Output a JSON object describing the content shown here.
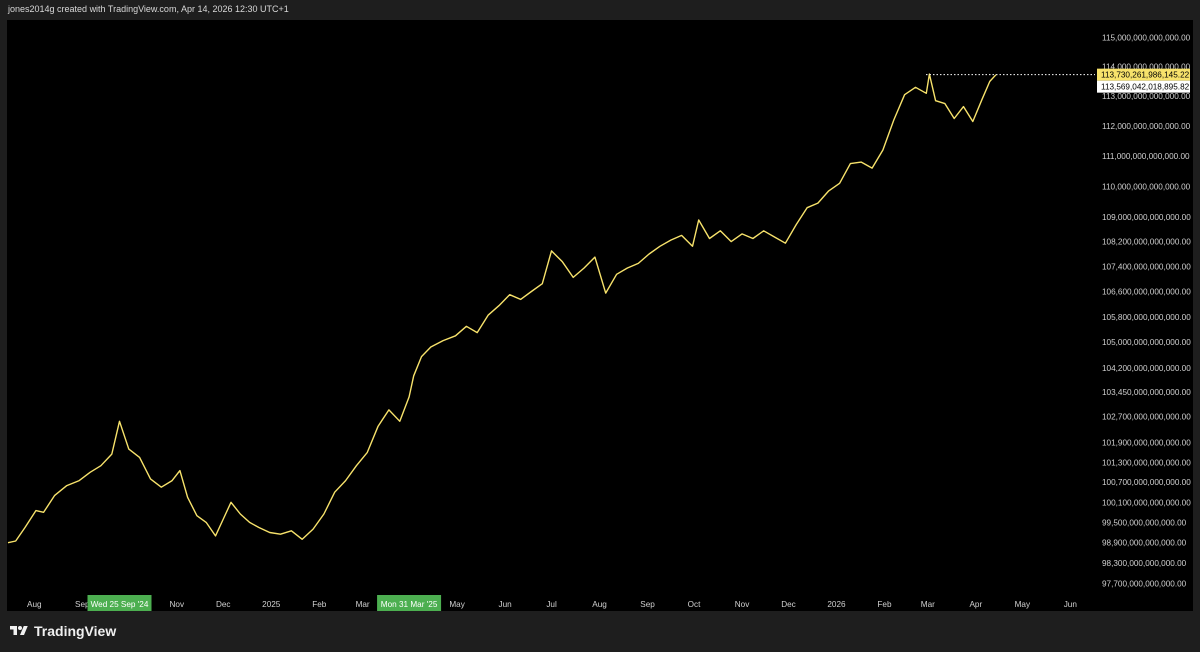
{
  "header": {
    "credit": "jones2014g created with TradingView.com, Apr 14, 2026 12:30 UTC+1"
  },
  "footer": {
    "brand": "TradingView"
  },
  "colors": {
    "line": "#f7e26b",
    "background": "#000000",
    "frame": "#1e1e1e",
    "axis_text": "#d0d0d0",
    "last_price_tag": "#f7e26b",
    "date_tag": "#4caf50"
  },
  "chart_data": {
    "type": "line",
    "title": "",
    "xlabel": "",
    "ylabel": "",
    "scale": "log",
    "grid": false,
    "series": [
      {
        "values": [
          [
            "2024-07-15",
            98900000000000.0
          ],
          [
            "2024-07-20",
            98950000000000.0
          ],
          [
            "2024-07-26",
            99350000000000.0
          ],
          [
            "2024-08-02",
            99850000000000.0
          ],
          [
            "2024-08-07",
            99800000000000.0
          ],
          [
            "2024-08-14",
            100300000000000.0
          ],
          [
            "2024-08-22",
            100600000000000.0
          ],
          [
            "2024-08-30",
            100750000000000.0
          ],
          [
            "2024-09-06",
            101000000000000.0
          ],
          [
            "2024-09-13",
            101200000000000.0
          ],
          [
            "2024-09-20",
            101550000000000.0
          ],
          [
            "2024-09-25",
            102550000000000.0
          ],
          [
            "2024-10-01",
            101700000000000.0
          ],
          [
            "2024-10-08",
            101450000000000.0
          ],
          [
            "2024-10-15",
            100800000000000.0
          ],
          [
            "2024-10-22",
            100550000000000.0
          ],
          [
            "2024-10-29",
            100750000000000.0
          ],
          [
            "2024-11-03",
            101050000000000.0
          ],
          [
            "2024-11-08",
            100250000000000.0
          ],
          [
            "2024-11-14",
            99700000000000.0
          ],
          [
            "2024-11-20",
            99500000000000.0
          ],
          [
            "2024-11-26",
            99100000000000.0
          ],
          [
            "2024-12-01",
            99600000000000.0
          ],
          [
            "2024-12-06",
            100100000000000.0
          ],
          [
            "2024-12-12",
            99750000000000.0
          ],
          [
            "2024-12-18",
            99500000000000.0
          ],
          [
            "2024-12-24",
            99350000000000.0
          ],
          [
            "2024-12-31",
            99200000000000.0
          ],
          [
            "2025-01-07",
            99150000000000.0
          ],
          [
            "2025-01-14",
            99250000000000.0
          ],
          [
            "2025-01-21",
            99000000000000.0
          ],
          [
            "2025-01-28",
            99300000000000.0
          ],
          [
            "2025-02-04",
            99750000000000.0
          ],
          [
            "2025-02-11",
            100400000000000.0
          ],
          [
            "2025-02-18",
            100750000000000.0
          ],
          [
            "2025-02-25",
            101200000000000.0
          ],
          [
            "2025-03-04",
            101600000000000.0
          ],
          [
            "2025-03-11",
            102400000000000.0
          ],
          [
            "2025-03-18",
            102900000000000.0
          ],
          [
            "2025-03-25",
            102550000000000.0
          ],
          [
            "2025-03-31",
            103300000000000.0
          ],
          [
            "2025-04-03",
            103950000000000.0
          ],
          [
            "2025-04-08",
            104550000000000.0
          ],
          [
            "2025-04-14",
            104850000000000.0
          ],
          [
            "2025-04-22",
            105050000000000.0
          ],
          [
            "2025-04-30",
            105200000000000.0
          ],
          [
            "2025-05-07",
            105500000000000.0
          ],
          [
            "2025-05-14",
            105300000000000.0
          ],
          [
            "2025-05-21",
            105850000000000.0
          ],
          [
            "2025-05-28",
            106150000000000.0
          ],
          [
            "2025-06-04",
            106500000000000.0
          ],
          [
            "2025-06-11",
            106350000000000.0
          ],
          [
            "2025-06-18",
            106600000000000.0
          ],
          [
            "2025-06-25",
            106850000000000.0
          ],
          [
            "2025-07-01",
            107900000000000.0
          ],
          [
            "2025-07-08",
            107550000000000.0
          ],
          [
            "2025-07-15",
            107050000000000.0
          ],
          [
            "2025-07-22",
            107350000000000.0
          ],
          [
            "2025-07-29",
            107700000000000.0
          ],
          [
            "2025-08-05",
            106550000000000.0
          ],
          [
            "2025-08-12",
            107150000000000.0
          ],
          [
            "2025-08-19",
            107350000000000.0
          ],
          [
            "2025-08-26",
            107500000000000.0
          ],
          [
            "2025-09-02",
            107800000000000.0
          ],
          [
            "2025-09-09",
            108050000000000.0
          ],
          [
            "2025-09-16",
            108250000000000.0
          ],
          [
            "2025-09-23",
            108400000000000.0
          ],
          [
            "2025-09-30",
            108050000000000.0
          ],
          [
            "2025-10-04",
            108900000000000.0
          ],
          [
            "2025-10-11",
            108300000000000.0
          ],
          [
            "2025-10-18",
            108550000000000.0
          ],
          [
            "2025-10-25",
            108200000000000.0
          ],
          [
            "2025-11-01",
            108450000000000.0
          ],
          [
            "2025-11-08",
            108300000000000.0
          ],
          [
            "2025-11-15",
            108550000000000.0
          ],
          [
            "2025-11-22",
            108350000000000.0
          ],
          [
            "2025-11-29",
            108150000000000.0
          ],
          [
            "2025-12-06",
            108750000000000.0
          ],
          [
            "2025-12-13",
            109300000000000.0
          ],
          [
            "2025-12-20",
            109450000000000.0
          ],
          [
            "2025-12-27",
            109850000000000.0
          ],
          [
            "2026-01-03",
            110100000000000.0
          ],
          [
            "2026-01-10",
            110750000000000.0
          ],
          [
            "2026-01-17",
            110800000000000.0
          ],
          [
            "2026-01-24",
            110600000000000.0
          ],
          [
            "2026-01-31",
            111200000000000.0
          ],
          [
            "2026-02-07",
            112200000000000.0
          ],
          [
            "2026-02-14",
            113050000000000.0
          ],
          [
            "2026-02-21",
            113300000000000.0
          ],
          [
            "2026-02-28",
            113100000000000.0
          ],
          [
            "2026-03-02",
            113750000000000.0
          ],
          [
            "2026-03-06",
            112850000000000.0
          ],
          [
            "2026-03-12",
            112750000000000.0
          ],
          [
            "2026-03-18",
            112250000000000.0
          ],
          [
            "2026-03-24",
            112650000000000.0
          ],
          [
            "2026-03-30",
            112150000000000.0
          ],
          [
            "2026-04-05",
            112900000000000.0
          ],
          [
            "2026-04-10",
            113500000000000.0
          ],
          [
            "2026-04-14",
            113730000000000.0
          ]
        ]
      }
    ],
    "x_ticks": [
      {
        "label": "Aug",
        "date": "2024-08-01"
      },
      {
        "label": "Sep",
        "date": "2024-09-01"
      },
      {
        "label": "Nov",
        "date": "2024-11-01"
      },
      {
        "label": "Dec",
        "date": "2024-12-01"
      },
      {
        "label": "2025",
        "date": "2025-01-01"
      },
      {
        "label": "Feb",
        "date": "2025-02-01"
      },
      {
        "label": "Mar",
        "date": "2025-03-01"
      },
      {
        "label": "May",
        "date": "2025-05-01"
      },
      {
        "label": "Jun",
        "date": "2025-06-01"
      },
      {
        "label": "Jul",
        "date": "2025-07-01"
      },
      {
        "label": "Aug",
        "date": "2025-08-01"
      },
      {
        "label": "Sep",
        "date": "2025-09-01"
      },
      {
        "label": "Oct",
        "date": "2025-10-01"
      },
      {
        "label": "Nov",
        "date": "2025-11-01"
      },
      {
        "label": "Dec",
        "date": "2025-12-01"
      },
      {
        "label": "2026",
        "date": "2026-01-01"
      },
      {
        "label": "Feb",
        "date": "2026-02-01"
      },
      {
        "label": "Mar",
        "date": "2026-03-01"
      },
      {
        "label": "Apr",
        "date": "2026-04-01"
      },
      {
        "label": "May",
        "date": "2026-05-01"
      },
      {
        "label": "Jun",
        "date": "2026-06-01"
      }
    ],
    "x_highlights": [
      {
        "label": "Wed 25 Sep '24",
        "date": "2024-09-25"
      },
      {
        "label": "Mon 31 Mar '25",
        "date": "2025-03-31"
      }
    ],
    "x_range": [
      "2024-07-15",
      "2026-06-15"
    ],
    "y_ticks": [
      {
        "label": "115,000,000,000,000.00",
        "value": 115000000000000.0
      },
      {
        "label": "114,000,000,000,000.00",
        "value": 114000000000000.0
      },
      {
        "label": "113,000,000,000,000.00",
        "value": 113000000000000.0
      },
      {
        "label": "112,000,000,000,000.00",
        "value": 112000000000000.0
      },
      {
        "label": "111,000,000,000,000.00",
        "value": 111000000000000.0
      },
      {
        "label": "110,000,000,000,000.00",
        "value": 110000000000000.0
      },
      {
        "label": "109,000,000,000,000.00",
        "value": 109000000000000.0
      },
      {
        "label": "108,200,000,000,000.00",
        "value": 108200000000000.0
      },
      {
        "label": "107,400,000,000,000.00",
        "value": 107400000000000.0
      },
      {
        "label": "106,600,000,000,000.00",
        "value": 106600000000000.0
      },
      {
        "label": "105,800,000,000,000.00",
        "value": 105800000000000.0
      },
      {
        "label": "105,000,000,000,000.00",
        "value": 105000000000000.0
      },
      {
        "label": "104,200,000,000,000.00",
        "value": 104200000000000.0
      },
      {
        "label": "103,450,000,000,000.00",
        "value": 103450000000000.0
      },
      {
        "label": "102,700,000,000,000.00",
        "value": 102700000000000.0
      },
      {
        "label": "101,900,000,000,000.00",
        "value": 101900000000000.0
      },
      {
        "label": "101,300,000,000,000.00",
        "value": 101300000000000.0
      },
      {
        "label": "100,700,000,000,000.00",
        "value": 100700000000000.0
      },
      {
        "label": "100,100,000,000,000.00",
        "value": 100100000000000.0
      },
      {
        "label": "99,500,000,000,000.00",
        "value": 99500000000000.0
      },
      {
        "label": "98,900,000,000,000.00",
        "value": 98900000000000.0
      },
      {
        "label": "98,300,000,000,000.00",
        "value": 98300000000000.0
      },
      {
        "label": "97,700,000,000,000.00",
        "value": 97700000000000.0
      }
    ],
    "last_price": {
      "label": "113,730,261,986,145.22",
      "value": 113730000000000.0
    },
    "secondary_price": {
      "label": "113,569,042,018,895.82",
      "value": 113570000000000.0
    }
  }
}
